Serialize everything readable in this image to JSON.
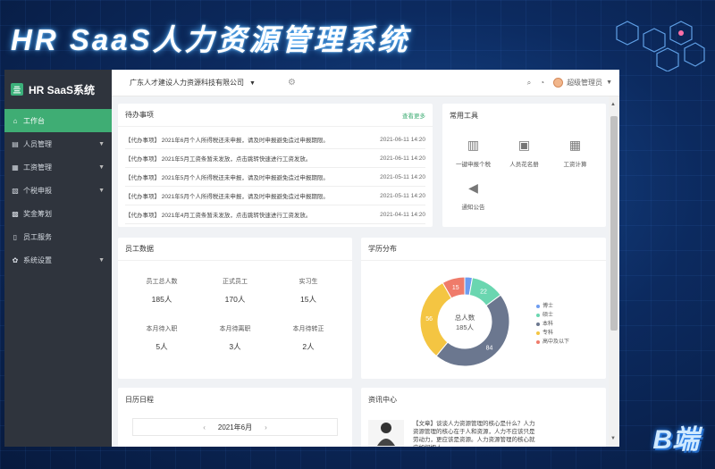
{
  "banner": {
    "title": "HR SaaS人力资源管理系统",
    "badge": "B端"
  },
  "app": {
    "logo_text": "HR SaaS系统",
    "logo_mark": "亖"
  },
  "sidebar": {
    "items": [
      {
        "label": "工作台",
        "icon": "home-icon",
        "glyph": "⌂",
        "active": true,
        "caret": ""
      },
      {
        "label": "人员管理",
        "icon": "people-icon",
        "glyph": "▤",
        "caret": "▼"
      },
      {
        "label": "工资管理",
        "icon": "salary-icon",
        "glyph": "▦",
        "caret": "▼"
      },
      {
        "label": "个税申报",
        "icon": "tax-icon",
        "glyph": "▧",
        "caret": "▼"
      },
      {
        "label": "奖金筹划",
        "icon": "bonus-icon",
        "glyph": "▩",
        "caret": ""
      },
      {
        "label": "员工服务",
        "icon": "phone-icon",
        "glyph": "▯",
        "caret": ""
      },
      {
        "label": "系统设置",
        "icon": "settings-icon",
        "glyph": "✿",
        "caret": "▼"
      }
    ]
  },
  "topbar": {
    "company": "广东人才建设人力资源科技有限公司",
    "dropdown": "▼",
    "user": "超级管理员",
    "user_caret": "▼"
  },
  "todo": {
    "title": "待办事项",
    "more": "查看更多",
    "rows": [
      {
        "text": "【代办事项】 2021年6月个人所得税还未申报，请及时申报避免造过申报期限。",
        "date": "2021-06-11 14:20"
      },
      {
        "text": "【代办事项】 2021年5月工资条暂未发放，点击跳转快速进行工资发放。",
        "date": "2021-06-11 14:20"
      },
      {
        "text": "【代办事项】 2021年5月个人所得税还未申报，请及时申报避免造过申报期限。",
        "date": "2021-05-11 14:20"
      },
      {
        "text": "【代办事项】 2021年5月个人所得税还未申报，请及时申报避免造过申报期限。",
        "date": "2021-05-11 14:20"
      },
      {
        "text": "【代办事项】 2021年4月工资条暂未发放，点击跳转快速进行工资发放。",
        "date": "2021-04-11 14:20"
      }
    ]
  },
  "tools": {
    "title": "常用工具",
    "items": [
      {
        "label": "一键申报个税",
        "icon": "building-icon",
        "glyph": "▥"
      },
      {
        "label": "人员花名册",
        "icon": "contact-icon",
        "glyph": "▣"
      },
      {
        "label": "工资计算",
        "icon": "calculator-icon",
        "glyph": "▦"
      },
      {
        "label": "通知公告",
        "icon": "megaphone-icon",
        "glyph": "◀"
      }
    ]
  },
  "staff": {
    "title": "员工数据",
    "items": [
      {
        "label": "员工总人数",
        "value": "185人"
      },
      {
        "label": "正式员工",
        "value": "170人"
      },
      {
        "label": "实习生",
        "value": "15人"
      },
      {
        "label": "本月待入职",
        "value": "5人"
      },
      {
        "label": "本月待离职",
        "value": "3人"
      },
      {
        "label": "本月待转正",
        "value": "2人"
      }
    ]
  },
  "education": {
    "title": "学历分布",
    "center_label": "总人数",
    "center_value": "185人"
  },
  "chart_data": {
    "type": "pie",
    "categories": [
      "博士",
      "硕士",
      "本科",
      "专科",
      "高中及以下"
    ],
    "values": [
      5,
      22,
      84,
      56,
      15
    ],
    "labels": [
      "",
      "22",
      "84",
      "56",
      "15"
    ],
    "colors": [
      "#6e9cf0",
      "#6ad6b0",
      "#6b778f",
      "#f4c542",
      "#ef7b6a"
    ]
  },
  "calendar": {
    "title": "日历日程",
    "month": "2021年6月",
    "prev": "‹",
    "next": "›"
  },
  "news": {
    "title": "资讯中心",
    "text": "【文章】谈谈人力资源管理的核心是什么？人力资源管理的核心在于人和资源，人力不应该只是劳动力，更应该是资源。人力资源管理的核心就应如何把人……"
  }
}
